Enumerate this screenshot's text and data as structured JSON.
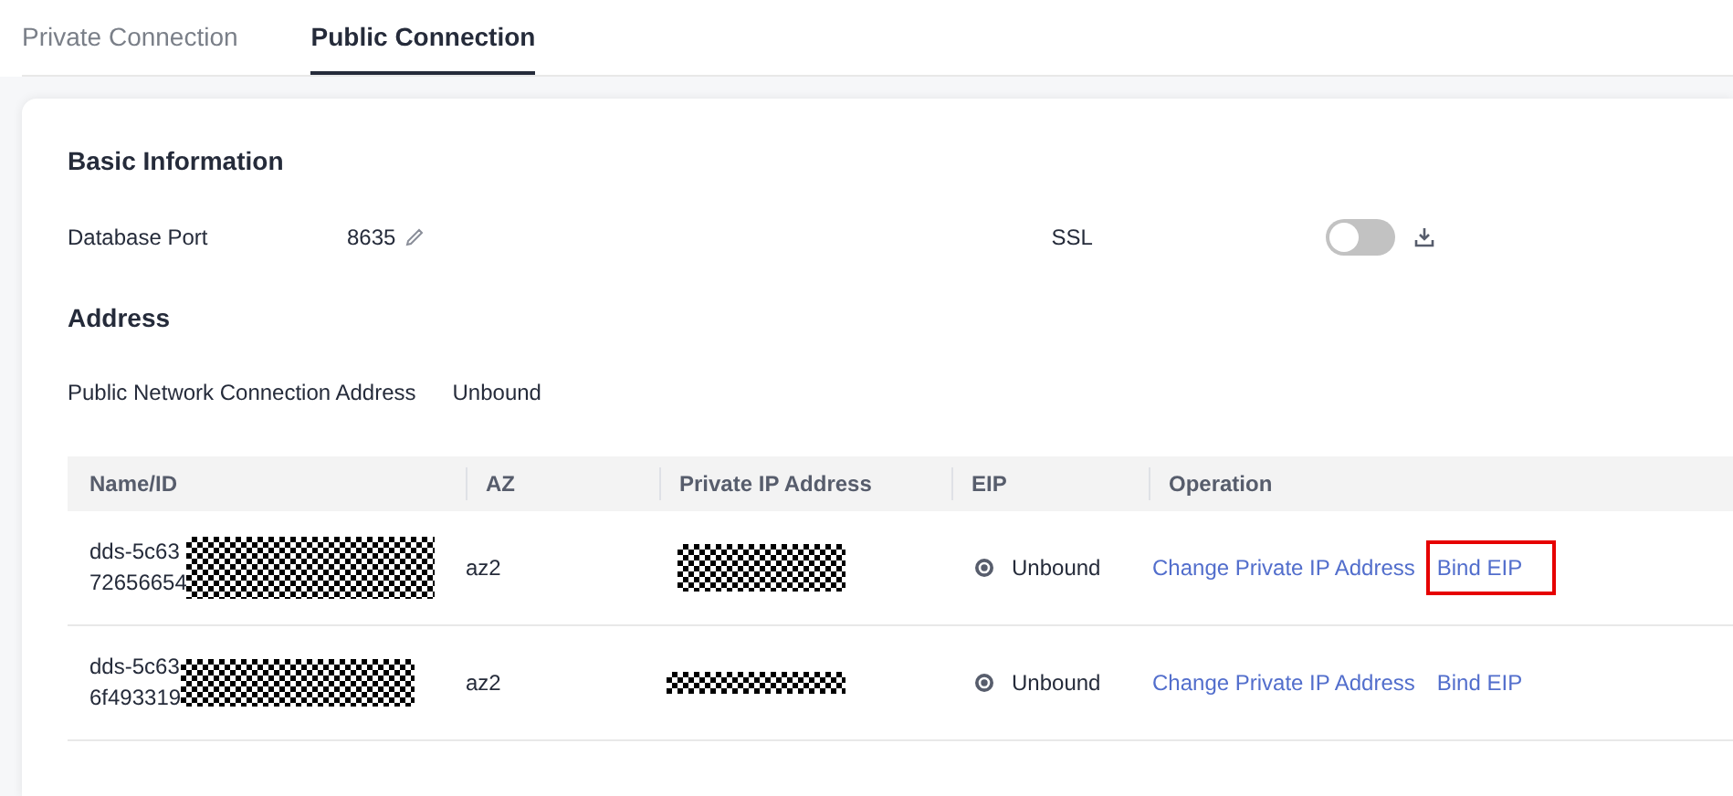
{
  "tabs": [
    {
      "label": "Private Connection",
      "selected": false
    },
    {
      "label": "Public Connection",
      "selected": true
    }
  ],
  "basic_information": {
    "title": "Basic Information",
    "database_port": {
      "label": "Database Port",
      "value": "8635"
    },
    "ssl": {
      "label": "SSL",
      "on": false
    }
  },
  "address": {
    "title": "Address",
    "public_network_connection_address": {
      "label": "Public Network Connection Address",
      "value": "Unbound"
    }
  },
  "table": {
    "columns": [
      "Name/ID",
      "AZ",
      "Private IP Address",
      "EIP",
      "Operation"
    ],
    "rows": [
      {
        "name_id": [
          "dds-5c63",
          "72656654"
        ],
        "az": "az2",
        "eip": "Unbound",
        "operations": [
          {
            "label": "Change Private IP Address",
            "highlighted": false
          },
          {
            "label": "Bind EIP",
            "highlighted": true
          }
        ]
      },
      {
        "name_id": [
          "dds-5c63",
          "6f493319"
        ],
        "az": "az2",
        "eip": "Unbound",
        "operations": [
          {
            "label": "Change Private IP Address",
            "highlighted": false
          },
          {
            "label": "Bind EIP",
            "highlighted": false
          }
        ]
      }
    ]
  }
}
